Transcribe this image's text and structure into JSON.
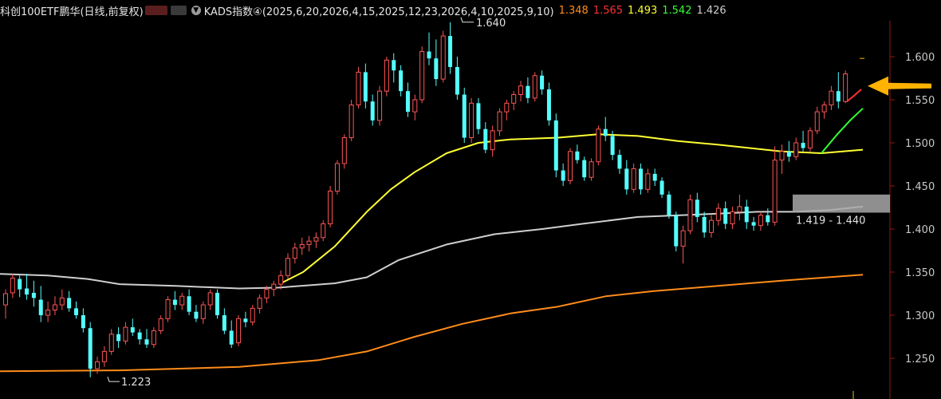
{
  "header": {
    "title": "科创100ETF鹏华(日线,前复权)",
    "indicator": "KADS指数④(2025,6,20,2026,4,15,2025,12,23,2026,4,10,2025,9,10)",
    "values": [
      {
        "text": "1.348",
        "color": "#ff8c1a"
      },
      {
        "text": "1.565",
        "color": "#ff3030"
      },
      {
        "text": "1.493",
        "color": "#ffff33"
      },
      {
        "text": "1.542",
        "color": "#33ff33"
      },
      {
        "text": "1.426",
        "color": "#cfcfcf"
      }
    ]
  },
  "chart_data": {
    "type": "candlestick",
    "ylim": [
      1.225,
      1.635
    ],
    "y_ticks": [
      "1.600",
      "1.550",
      "1.500",
      "1.450",
      "1.400",
      "1.350",
      "1.300",
      "1.250"
    ],
    "colors": {
      "up": "#ff5555",
      "down": "#54ffff",
      "ma_orange": "#ff8c1a",
      "ma_gray": "#cfcfcf",
      "ma_yellow": "#ffff33",
      "red_line": "#ff3030",
      "green_line": "#33ff33",
      "arrow": "#ffb300"
    },
    "annotations": {
      "high": "1.640",
      "low": "1.223",
      "zone": "1.419 - 1.440"
    },
    "zone": [
      1.419,
      1.44
    ],
    "ohlc": [
      [
        1.312,
        1.33,
        1.296,
        1.325
      ],
      [
        1.326,
        1.348,
        1.32,
        1.343
      ],
      [
        1.342,
        1.346,
        1.321,
        1.33
      ],
      [
        1.331,
        1.348,
        1.318,
        1.324
      ],
      [
        1.326,
        1.34,
        1.31,
        1.32
      ],
      [
        1.318,
        1.334,
        1.292,
        1.3
      ],
      [
        1.3,
        1.316,
        1.292,
        1.306
      ],
      [
        1.306,
        1.322,
        1.3,
        1.312
      ],
      [
        1.312,
        1.33,
        1.306,
        1.32
      ],
      [
        1.32,
        1.328,
        1.304,
        1.308
      ],
      [
        1.308,
        1.316,
        1.296,
        1.3
      ],
      [
        1.3,
        1.308,
        1.28,
        1.285
      ],
      [
        1.285,
        1.292,
        1.228,
        1.238
      ],
      [
        1.238,
        1.252,
        1.232,
        1.246
      ],
      [
        1.246,
        1.264,
        1.24,
        1.258
      ],
      [
        1.258,
        1.284,
        1.254,
        1.278
      ],
      [
        1.278,
        1.286,
        1.262,
        1.27
      ],
      [
        1.27,
        1.292,
        1.266,
        1.286
      ],
      [
        1.286,
        1.296,
        1.276,
        1.28
      ],
      [
        1.28,
        1.284,
        1.266,
        1.272
      ],
      [
        1.272,
        1.284,
        1.262,
        1.266
      ],
      [
        1.266,
        1.286,
        1.262,
        1.282
      ],
      [
        1.282,
        1.3,
        1.278,
        1.296
      ],
      [
        1.296,
        1.322,
        1.292,
        1.318
      ],
      [
        1.318,
        1.328,
        1.306,
        1.312
      ],
      [
        1.312,
        1.326,
        1.306,
        1.322
      ],
      [
        1.322,
        1.33,
        1.3,
        1.304
      ],
      [
        1.304,
        1.312,
        1.292,
        1.296
      ],
      [
        1.296,
        1.316,
        1.29,
        1.312
      ],
      [
        1.312,
        1.33,
        1.306,
        1.326
      ],
      [
        1.326,
        1.33,
        1.296,
        1.3
      ],
      [
        1.3,
        1.308,
        1.278,
        1.282
      ],
      [
        1.282,
        1.294,
        1.262,
        1.266
      ],
      [
        1.268,
        1.3,
        1.264,
        1.296
      ],
      [
        1.296,
        1.304,
        1.286,
        1.292
      ],
      [
        1.292,
        1.312,
        1.288,
        1.308
      ],
      [
        1.308,
        1.324,
        1.302,
        1.32
      ],
      [
        1.32,
        1.334,
        1.314,
        1.33
      ],
      [
        1.33,
        1.34,
        1.322,
        1.336
      ],
      [
        1.336,
        1.352,
        1.33,
        1.346
      ],
      [
        1.346,
        1.372,
        1.342,
        1.366
      ],
      [
        1.366,
        1.384,
        1.36,
        1.378
      ],
      [
        1.378,
        1.39,
        1.37,
        1.382
      ],
      [
        1.382,
        1.392,
        1.374,
        1.386
      ],
      [
        1.386,
        1.396,
        1.378,
        1.39
      ],
      [
        1.39,
        1.41,
        1.386,
        1.406
      ],
      [
        1.406,
        1.45,
        1.402,
        1.444
      ],
      [
        1.444,
        1.48,
        1.44,
        1.476
      ],
      [
        1.476,
        1.51,
        1.47,
        1.506
      ],
      [
        1.506,
        1.55,
        1.502,
        1.544
      ],
      [
        1.544,
        1.588,
        1.54,
        1.582
      ],
      [
        1.582,
        1.592,
        1.54,
        1.548
      ],
      [
        1.548,
        1.556,
        1.52,
        1.526
      ],
      [
        1.526,
        1.566,
        1.52,
        1.56
      ],
      [
        1.56,
        1.6,
        1.554,
        1.596
      ],
      [
        1.596,
        1.604,
        1.57,
        1.584
      ],
      [
        1.584,
        1.59,
        1.554,
        1.56
      ],
      [
        1.56,
        1.57,
        1.53,
        1.536
      ],
      [
        1.536,
        1.556,
        1.526,
        1.55
      ],
      [
        1.55,
        1.612,
        1.546,
        1.606
      ],
      [
        1.606,
        1.628,
        1.59,
        1.598
      ],
      [
        1.598,
        1.62,
        1.566,
        1.574
      ],
      [
        1.574,
        1.63,
        1.57,
        1.624
      ],
      [
        1.624,
        1.64,
        1.58,
        1.588
      ],
      [
        1.588,
        1.6,
        1.55,
        1.556
      ],
      [
        1.556,
        1.564,
        1.5,
        1.506
      ],
      [
        1.506,
        1.552,
        1.5,
        1.546
      ],
      [
        1.546,
        1.552,
        1.51,
        1.516
      ],
      [
        1.516,
        1.524,
        1.488,
        1.492
      ],
      [
        1.492,
        1.52,
        1.484,
        1.514
      ],
      [
        1.514,
        1.54,
        1.508,
        1.536
      ],
      [
        1.536,
        1.55,
        1.526,
        1.546
      ],
      [
        1.546,
        1.56,
        1.538,
        1.556
      ],
      [
        1.556,
        1.572,
        1.548,
        1.566
      ],
      [
        1.566,
        1.576,
        1.546,
        1.552
      ],
      [
        1.552,
        1.582,
        1.548,
        1.578
      ],
      [
        1.578,
        1.584,
        1.556,
        1.562
      ],
      [
        1.562,
        1.57,
        1.52,
        1.526
      ],
      [
        1.526,
        1.534,
        1.46,
        1.468
      ],
      [
        1.468,
        1.476,
        1.45,
        1.456
      ],
      [
        1.456,
        1.494,
        1.452,
        1.49
      ],
      [
        1.49,
        1.498,
        1.476,
        1.48
      ],
      [
        1.48,
        1.484,
        1.456,
        1.46
      ],
      [
        1.46,
        1.482,
        1.456,
        1.478
      ],
      [
        1.478,
        1.52,
        1.474,
        1.516
      ],
      [
        1.516,
        1.53,
        1.502,
        1.508
      ],
      [
        1.508,
        1.514,
        1.48,
        1.486
      ],
      [
        1.486,
        1.492,
        1.464,
        1.47
      ],
      [
        1.47,
        1.48,
        1.44,
        1.446
      ],
      [
        1.446,
        1.476,
        1.442,
        1.47
      ],
      [
        1.47,
        1.476,
        1.44,
        1.446
      ],
      [
        1.446,
        1.47,
        1.442,
        1.464
      ],
      [
        1.464,
        1.47,
        1.45,
        1.456
      ],
      [
        1.456,
        1.46,
        1.436,
        1.44
      ],
      [
        1.44,
        1.444,
        1.412,
        1.416
      ],
      [
        1.416,
        1.42,
        1.374,
        1.38
      ],
      [
        1.38,
        1.404,
        1.36,
        1.398
      ],
      [
        1.398,
        1.44,
        1.394,
        1.434
      ],
      [
        1.434,
        1.442,
        1.408,
        1.414
      ],
      [
        1.414,
        1.42,
        1.39,
        1.396
      ],
      [
        1.396,
        1.416,
        1.39,
        1.41
      ],
      [
        1.41,
        1.43,
        1.404,
        1.424
      ],
      [
        1.424,
        1.432,
        1.4,
        1.406
      ],
      [
        1.406,
        1.426,
        1.4,
        1.42
      ],
      [
        1.42,
        1.44,
        1.41,
        1.426
      ],
      [
        1.426,
        1.434,
        1.4,
        1.408
      ],
      [
        1.408,
        1.414,
        1.398,
        1.404
      ],
      [
        1.404,
        1.42,
        1.398,
        1.416
      ],
      [
        1.416,
        1.424,
        1.404,
        1.408
      ],
      [
        1.408,
        1.496,
        1.404,
        1.48
      ],
      [
        1.48,
        1.498,
        1.464,
        1.49
      ],
      [
        1.49,
        1.502,
        1.478,
        1.484
      ],
      [
        1.484,
        1.506,
        1.48,
        1.5
      ],
      [
        1.5,
        1.514,
        1.49,
        1.494
      ],
      [
        1.494,
        1.518,
        1.49,
        1.514
      ],
      [
        1.514,
        1.542,
        1.51,
        1.536
      ],
      [
        1.536,
        1.548,
        1.528,
        1.544
      ],
      [
        1.544,
        1.566,
        1.538,
        1.56
      ],
      [
        1.56,
        1.582,
        1.54,
        1.548
      ],
      [
        1.548,
        1.584,
        1.546,
        1.58
      ]
    ],
    "ma_orange": [
      [
        0,
        1.235
      ],
      [
        150,
        1.236
      ],
      [
        300,
        1.24
      ],
      [
        400,
        1.248
      ],
      [
        460,
        1.258
      ],
      [
        520,
        1.275
      ],
      [
        580,
        1.29
      ],
      [
        640,
        1.302
      ],
      [
        700,
        1.31
      ],
      [
        760,
        1.322
      ],
      [
        820,
        1.328
      ],
      [
        900,
        1.334
      ],
      [
        980,
        1.34
      ],
      [
        1082,
        1.347
      ]
    ],
    "ma_gray": [
      [
        0,
        1.348
      ],
      [
        60,
        1.346
      ],
      [
        110,
        1.342
      ],
      [
        150,
        1.336
      ],
      [
        220,
        1.334
      ],
      [
        300,
        1.331
      ],
      [
        350,
        1.332
      ],
      [
        420,
        1.337
      ],
      [
        460,
        1.344
      ],
      [
        500,
        1.364
      ],
      [
        560,
        1.382
      ],
      [
        620,
        1.394
      ],
      [
        680,
        1.4
      ],
      [
        730,
        1.406
      ],
      [
        800,
        1.414
      ],
      [
        880,
        1.417
      ],
      [
        950,
        1.42
      ],
      [
        1000,
        1.42
      ],
      [
        1040,
        1.422
      ],
      [
        1082,
        1.426
      ]
    ],
    "ma_yellow": [
      [
        350,
        1.336
      ],
      [
        380,
        1.35
      ],
      [
        420,
        1.38
      ],
      [
        460,
        1.42
      ],
      [
        490,
        1.446
      ],
      [
        520,
        1.466
      ],
      [
        560,
        1.488
      ],
      [
        600,
        1.5
      ],
      [
        640,
        1.504
      ],
      [
        700,
        1.506
      ],
      [
        750,
        1.51
      ],
      [
        800,
        1.508
      ],
      [
        850,
        1.502
      ],
      [
        900,
        1.498
      ],
      [
        940,
        1.494
      ],
      [
        980,
        1.49
      ],
      [
        1030,
        1.488
      ],
      [
        1082,
        1.492
      ]
    ],
    "red_line": [
      [
        1062,
        1.548
      ],
      [
        1070,
        1.554
      ],
      [
        1080,
        1.562
      ]
    ],
    "green_line": [
      [
        1030,
        1.488
      ],
      [
        1050,
        1.51
      ],
      [
        1066,
        1.526
      ],
      [
        1082,
        1.54
      ]
    ]
  }
}
